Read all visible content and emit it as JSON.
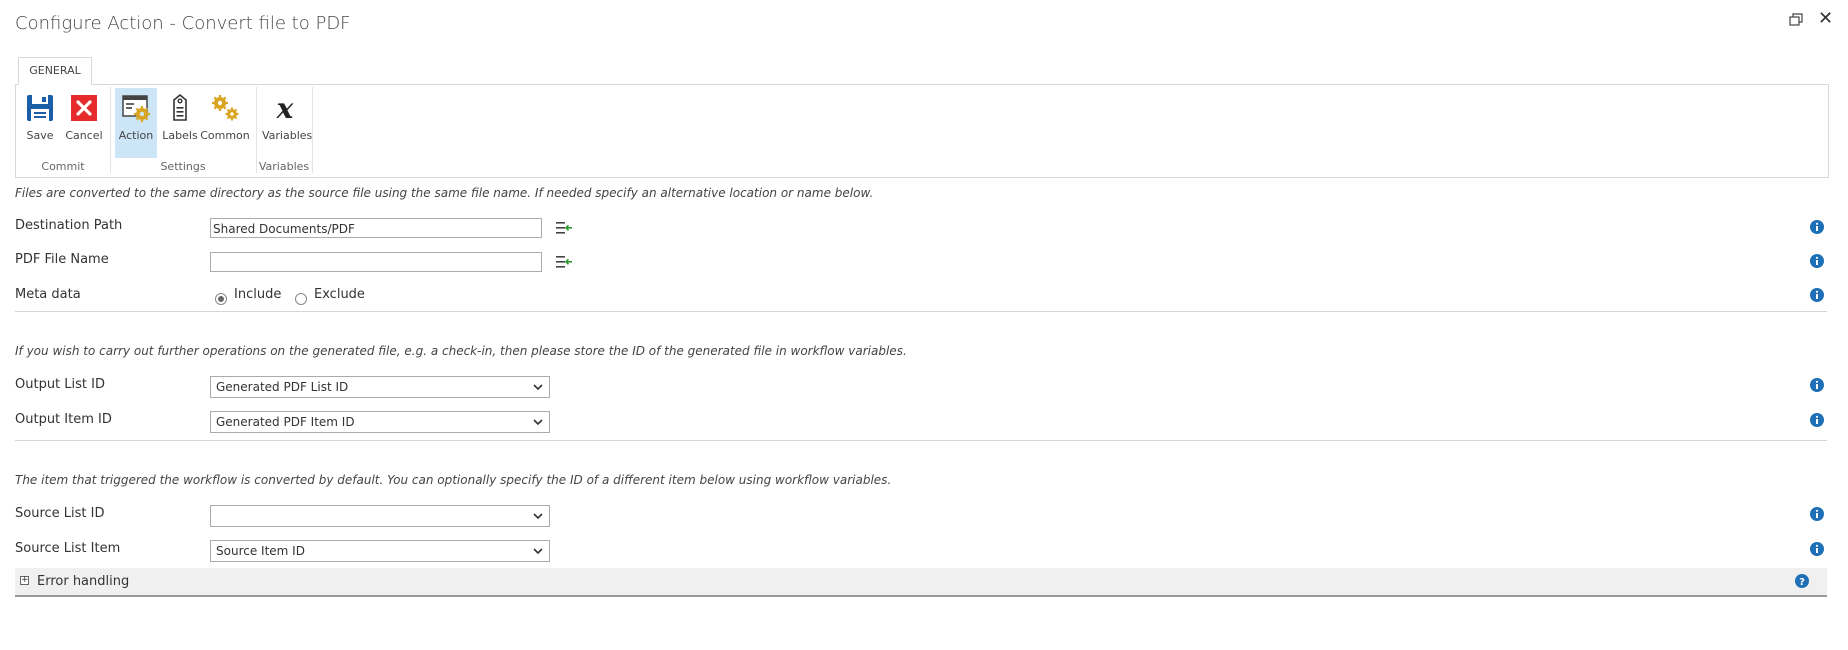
{
  "window": {
    "title": "Configure Action - Convert file to PDF"
  },
  "ribbon": {
    "tab": "GENERAL",
    "buttons": {
      "save": "Save",
      "cancel": "Cancel",
      "action": "Action",
      "labels": "Labels",
      "common": "Common",
      "variables": "Variables"
    },
    "groups": {
      "commit": "Commit",
      "settings": "Settings",
      "variables": "Variables"
    }
  },
  "section1": {
    "note": "Files are converted to the same directory as the source file using the same file name. If needed specify an alternative location or name below.",
    "destination_path": {
      "label": "Destination Path",
      "value": "Shared Documents/PDF"
    },
    "pdf_file_name": {
      "label": "PDF File Name",
      "value": ""
    },
    "meta_data": {
      "label": "Meta data",
      "include": "Include",
      "exclude": "Exclude",
      "selected": "Include"
    }
  },
  "section2": {
    "note": "If you wish to carry out further operations on the generated file, e.g. a check-in, then please store the ID of the generated file in workflow variables.",
    "output_list_id": {
      "label": "Output List ID",
      "value": "Generated PDF List ID"
    },
    "output_item_id": {
      "label": "Output Item ID",
      "value": "Generated PDF Item ID"
    }
  },
  "section3": {
    "note": "The item that triggered the workflow is converted by default. You can optionally specify the ID of a different item below using workflow variables.",
    "source_list_id": {
      "label": "Source List ID",
      "value": ""
    },
    "source_list_item": {
      "label": "Source List Item",
      "value": "Source Item ID"
    }
  },
  "error_handling": {
    "label": "Error handling",
    "expand_glyph": "+"
  },
  "colors": {
    "accent_blue": "#1e6fb5",
    "save_blue": "#1a5fa8",
    "cancel_red": "#e52b2b",
    "gear_gold": "#d9a521",
    "active_bg": "#cde6f7"
  }
}
